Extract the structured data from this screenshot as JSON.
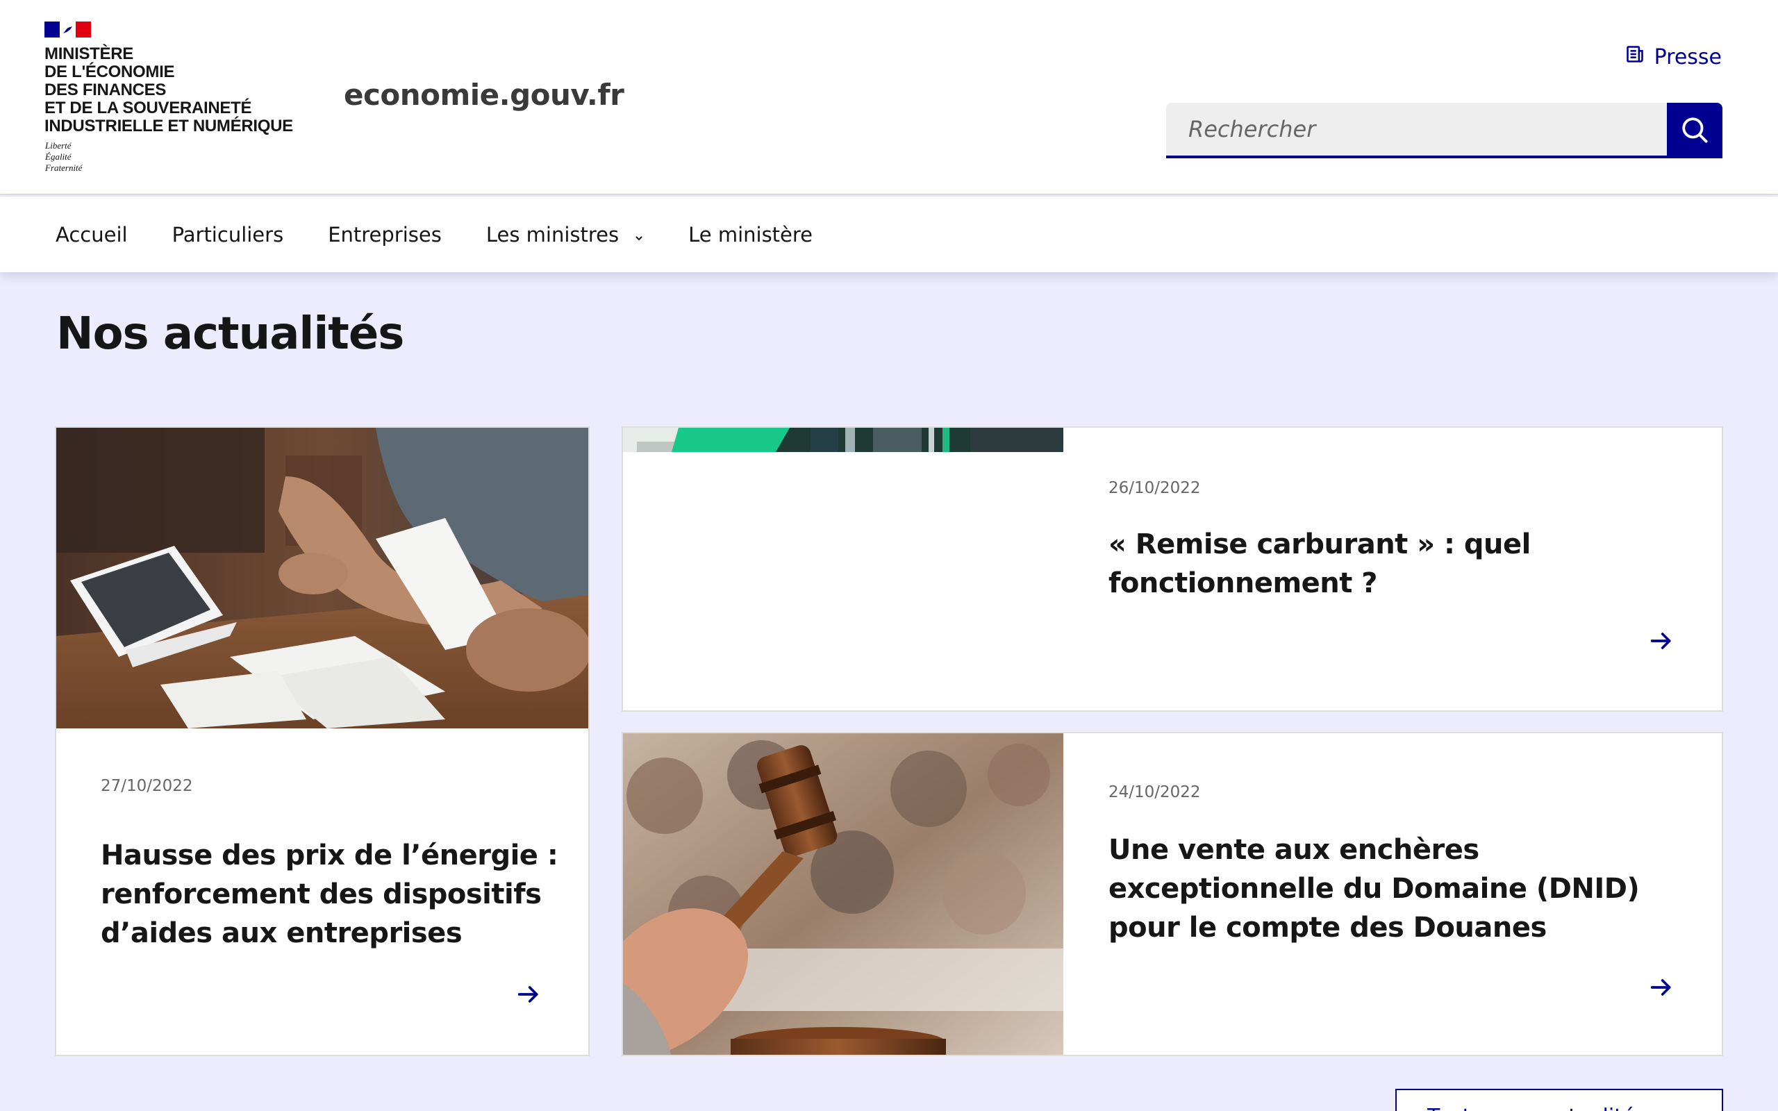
{
  "header": {
    "ministry_lines": [
      "MINISTÈRE",
      "DE L'ÉCONOMIE",
      "DES FINANCES",
      "ET DE LA SOUVERAINETÉ",
      "INDUSTRIELLE ET NUMÉRIQUE"
    ],
    "motto_lines": [
      "Liberté",
      "Égalité",
      "Fraternité"
    ],
    "site_name": "economie.gouv.fr",
    "presse_label": "Presse",
    "search": {
      "placeholder": "Rechercher"
    }
  },
  "nav": {
    "items": [
      {
        "label": "Accueil"
      },
      {
        "label": "Particuliers"
      },
      {
        "label": "Entreprises"
      },
      {
        "label": "Les ministres"
      },
      {
        "label": "Le ministère"
      }
    ]
  },
  "main": {
    "section_title": "Nos actualités",
    "cards": [
      {
        "date": "27/10/2022",
        "title": "Hausse des prix de l’énergie : renforcement des dispositifs d’aides aux entreprises"
      },
      {
        "date": "26/10/2022",
        "title": "« Remise carburant » : quel fonctionnement ?"
      },
      {
        "date": "24/10/2022",
        "title": "Une vente aux enchères exceptionnelle du Domaine (DNID) pour le compte des Douanes"
      }
    ],
    "all_news_label": "Toutes nos actualités"
  },
  "colors": {
    "brand_blue": "#000091",
    "brand_red": "#e1000f",
    "page_background": "#ececfe",
    "text": "#161616"
  },
  "icons": {
    "search": "search-icon",
    "presse": "newspaper-icon",
    "dropdown": "chevron-down-icon",
    "card_link": "arrow-right-icon"
  }
}
